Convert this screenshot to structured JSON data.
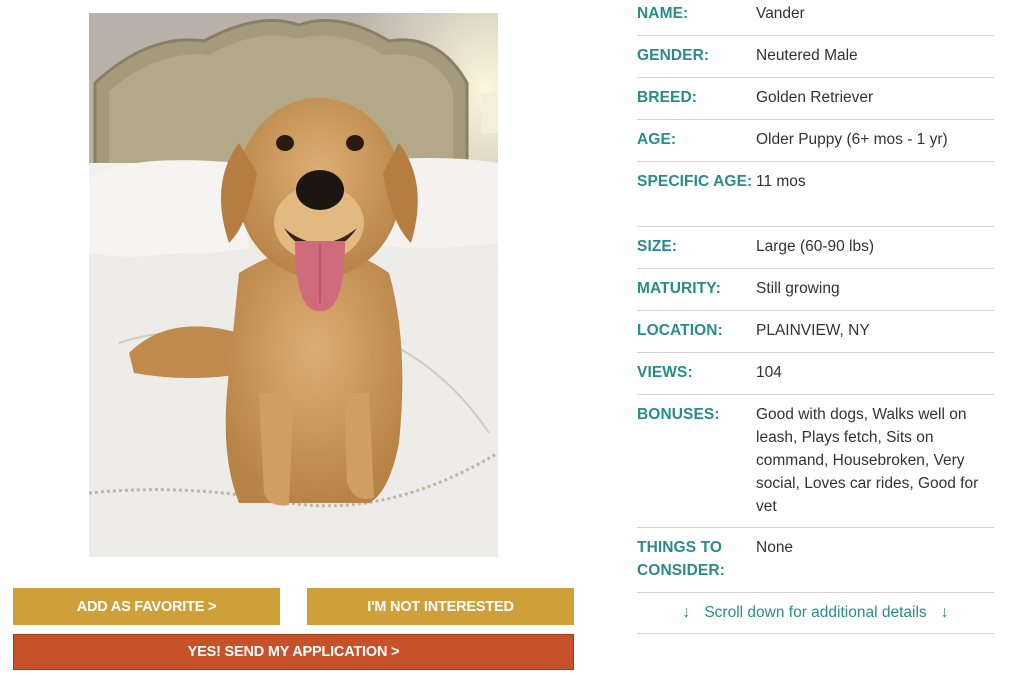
{
  "photo": {
    "alt": "Golden retriever puppy sitting on a bed"
  },
  "buttons": {
    "favorite": "ADD AS FAVORITE >",
    "not_interested": "I'M NOT INTERESTED",
    "apply": "YES! SEND MY APPLICATION >"
  },
  "details": {
    "name": {
      "label": "NAME:",
      "value": "Vander"
    },
    "gender": {
      "label": "GENDER:",
      "value": "Neutered Male"
    },
    "breed": {
      "label": "BREED:",
      "value": "Golden Retriever"
    },
    "age": {
      "label": "AGE:",
      "value": "Older Puppy (6+ mos - 1 yr)"
    },
    "specific_age": {
      "label": "SPECIFIC AGE:",
      "value": "11 mos"
    },
    "size": {
      "label": "SIZE:",
      "value": "Large (60-90 lbs)"
    },
    "maturity": {
      "label": "MATURITY:",
      "value": "Still growing"
    },
    "location": {
      "label": "LOCATION:",
      "value": "PLAINVIEW, NY"
    },
    "views": {
      "label": "VIEWS:",
      "value": "104"
    },
    "bonuses": {
      "label": "BONUSES:",
      "value": "Good with dogs, Walks well on leash, Plays fetch, Sits on command, Housebroken, Very social, Loves car rides, Good for vet"
    },
    "things": {
      "label": "THINGS TO CONSIDER:",
      "value": "None"
    }
  },
  "scroll_hint": {
    "text": "Scroll down for additional details",
    "arrow": "↓"
  },
  "colors": {
    "teal": "#2a8b8b",
    "gold": "#cfa03a",
    "rust": "#c7522a"
  }
}
